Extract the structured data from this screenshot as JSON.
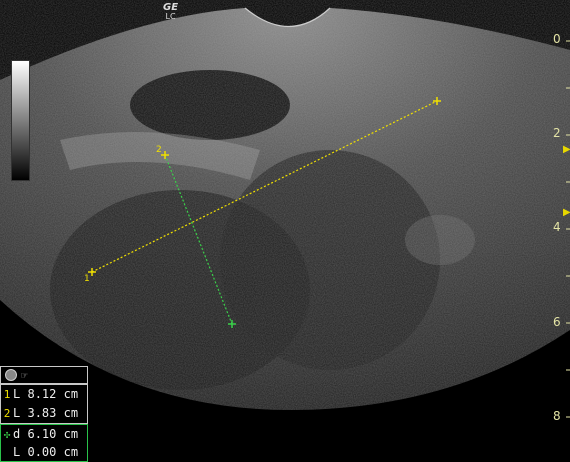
{
  "logo": {
    "brand": "GE",
    "sub": "LC"
  },
  "depth_scale": {
    "labels": [
      "0",
      "2",
      "4",
      "6",
      "8"
    ]
  },
  "measurements": [
    {
      "index": "1",
      "type": "L",
      "value": "8.12 cm"
    },
    {
      "index": "2",
      "type": "L",
      "value": "3.83 cm"
    }
  ],
  "distance": {
    "type": "d",
    "value": "6.10 cm",
    "sub_type": "L",
    "sub_value": "0.00 cm"
  },
  "colors": {
    "caliper_1": "#f0e000",
    "caliper_2": "#3ad14a",
    "scale_text": "#e4e4a6"
  }
}
